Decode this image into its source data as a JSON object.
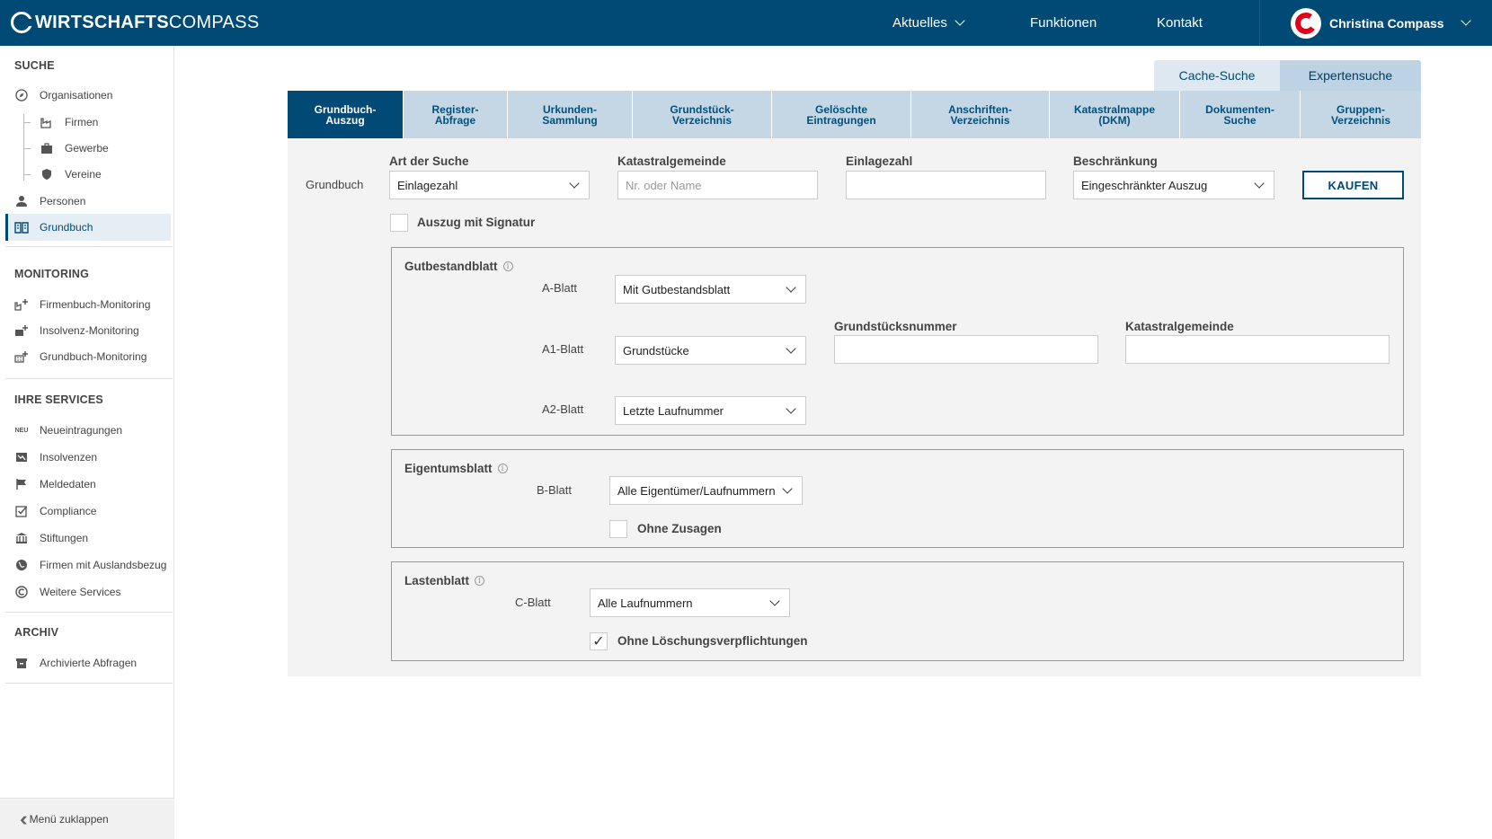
{
  "brand": {
    "bold": "WIRTSCHAFTS",
    "light": "COMPASS"
  },
  "nav": {
    "aktuelles": "Aktuelles",
    "funktionen": "Funktionen",
    "kontakt": "Kontakt"
  },
  "user": {
    "name": "Christina Compass"
  },
  "sidebar": {
    "headings": {
      "suche": "SUCHE",
      "monitoring": "MONITORING",
      "services": "IHRE SERVICES",
      "archiv": "ARCHIV"
    },
    "suche": [
      {
        "label": "Organisationen",
        "icon": "compass-icon"
      },
      {
        "label": "Firmen",
        "icon": "factory-icon"
      },
      {
        "label": "Gewerbe",
        "icon": "briefcase-icon"
      },
      {
        "label": "Vereine",
        "icon": "badge-icon"
      },
      {
        "label": "Personen",
        "icon": "person-icon"
      },
      {
        "label": "Grundbuch",
        "icon": "book-icon"
      }
    ],
    "monitoring": [
      {
        "label": "Firmenbuch-Monitoring",
        "icon": "factory-plus-icon"
      },
      {
        "label": "Insolvenz-Monitoring",
        "icon": "chart-plus-icon"
      },
      {
        "label": "Grundbuch-Monitoring",
        "icon": "building-plus-icon"
      }
    ],
    "neu_badge": "NEU",
    "services": [
      {
        "label": "Neueintragungen",
        "icon": "new-badge-icon"
      },
      {
        "label": "Insolvenzen",
        "icon": "chart-down-icon"
      },
      {
        "label": "Meldedaten",
        "icon": "flag-icon"
      },
      {
        "label": "Compliance",
        "icon": "checkbox-icon"
      },
      {
        "label": "Stiftungen",
        "icon": "institution-icon"
      },
      {
        "label": "Firmen mit Auslandsbezug",
        "icon": "globe-icon"
      },
      {
        "label": "Weitere Services",
        "icon": "compass-c-icon"
      }
    ],
    "archiv": [
      {
        "label": "Archivierte Abfragen",
        "icon": "archive-icon"
      }
    ],
    "collapse_label": "Menü zuklappen"
  },
  "search_tabs": {
    "cache": "Cache-Suche",
    "expert": "Expertensuche"
  },
  "tabs": [
    {
      "l1": "Grundbuch-",
      "l2": "Auszug"
    },
    {
      "l1": "Register-",
      "l2": "Abfrage"
    },
    {
      "l1": "Urkunden-",
      "l2": "Sammlung"
    },
    {
      "l1": "Grundstück-",
      "l2": "Verzeichnis"
    },
    {
      "l1": "Gelöschte",
      "l2": "Eintragungen"
    },
    {
      "l1": "Anschriften-",
      "l2": "Verzeichnis"
    },
    {
      "l1": "Katastralmappe",
      "l2": "(DKM)"
    },
    {
      "l1": "Dokumenten-",
      "l2": "Suche"
    },
    {
      "l1": "Gruppen-",
      "l2": "Verzeichnis"
    }
  ],
  "form": {
    "row_label": "Grundbuch",
    "art_label": "Art der Suche",
    "art_value": "Einlagezahl",
    "kg_label": "Katastralgemeinde",
    "kg_placeholder": "Nr. oder Name",
    "ez_label": "Einlagezahl",
    "ez_value": "",
    "beschr_label": "Beschränkung",
    "beschr_value": "Eingeschränkter Auszug",
    "buy_label": "KAUFEN",
    "signatur_label": "Auszug mit Signatur",
    "signatur_checked": false
  },
  "gutbestand": {
    "title": "Gutbestandblatt",
    "a_label": "A-Blatt",
    "a_value": "Mit Gutbestandsblatt",
    "a1_label": "A1-Blatt",
    "a1_value": "Grundstücke",
    "gst_label": "Grundstücksnummer",
    "gst_value": "",
    "kg_label": "Katastralgemeinde",
    "kg_value": "",
    "a2_label": "A2-Blatt",
    "a2_value": "Letzte Laufnummer"
  },
  "eigentum": {
    "title": "Eigentumsblatt",
    "b_label": "B-Blatt",
    "b_value": "Alle Eigentümer/Laufnummern",
    "zusagen_label": "Ohne Zusagen",
    "zusagen_checked": false
  },
  "lasten": {
    "title": "Lastenblatt",
    "c_label": "C-Blatt",
    "c_value": "Alle Laufnummern",
    "loesch_label": "Ohne Löschungsverpflichtungen",
    "loesch_checked": true,
    "check_glyph": "✓"
  },
  "info_glyph": "i",
  "colors": {
    "brand": "#004a75",
    "tab_bg": "#c5d7e4",
    "panel_bg": "#f3f3f3",
    "accent_red": "#e2001a"
  }
}
